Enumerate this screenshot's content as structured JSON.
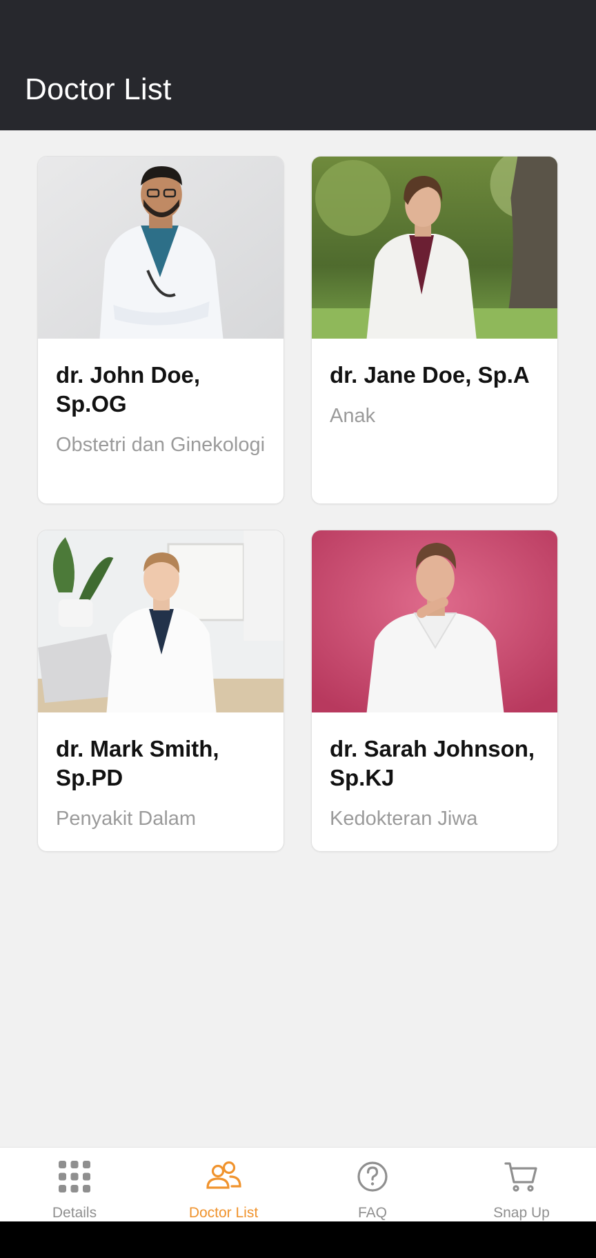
{
  "header": {
    "title": "Doctor List"
  },
  "doctors": [
    {
      "name": "dr. John Doe, Sp.OG",
      "specialty": "Obstetri dan Ginekologi",
      "photo": "doctor-with-glasses-photo"
    },
    {
      "name": "dr. Jane Doe, Sp.A",
      "specialty": "Anak",
      "photo": "female-doctor-outdoors-photo"
    },
    {
      "name": "dr. Mark Smith, Sp.PD",
      "specialty": "Penyakit Dalam",
      "photo": "doctor-at-desk-photo"
    },
    {
      "name": "dr. Sarah Johnson, Sp.KJ",
      "specialty": "Kedokteran Jiwa",
      "photo": "doctor-pink-background-photo"
    }
  ],
  "tabs": [
    {
      "label": "Details",
      "icon": "grid-icon",
      "active": false
    },
    {
      "label": "Doctor List",
      "icon": "users-icon",
      "active": true
    },
    {
      "label": "FAQ",
      "icon": "question-circle-icon",
      "active": false
    },
    {
      "label": "Snap Up",
      "icon": "cart-icon",
      "active": false
    }
  ],
  "colors": {
    "header_bg": "#27282d",
    "page_bg": "#f1f1f1",
    "accent": "#f0932d",
    "inactive": "#8f8f8f"
  }
}
